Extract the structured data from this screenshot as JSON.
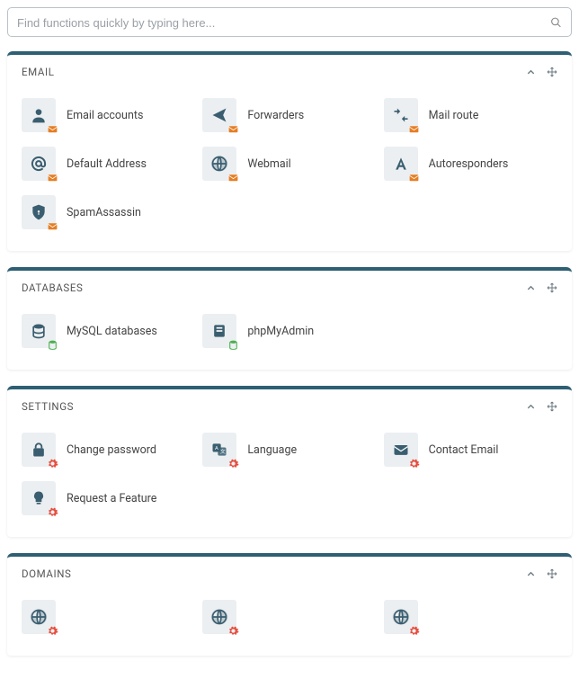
{
  "search": {
    "placeholder": "Find functions quickly by typing here..."
  },
  "panels": [
    {
      "key": "email",
      "title": "EMAIL",
      "badge": "env",
      "items": [
        {
          "label": "Email accounts",
          "icon": "user",
          "name": "email-accounts"
        },
        {
          "label": "Forwarders",
          "icon": "send",
          "name": "forwarders"
        },
        {
          "label": "Mail route",
          "icon": "route",
          "name": "mail-route"
        },
        {
          "label": "Default Address",
          "icon": "at",
          "name": "default-address"
        },
        {
          "label": "Webmail",
          "icon": "globe",
          "name": "webmail"
        },
        {
          "label": "Autoresponders",
          "icon": "typea",
          "name": "autoresponders"
        },
        {
          "label": "SpamAssassin",
          "icon": "shield",
          "name": "spam-assassin"
        }
      ]
    },
    {
      "key": "databases",
      "title": "DATABASES",
      "badge": "db",
      "items": [
        {
          "label": "MySQL databases",
          "icon": "dbcyl",
          "name": "mysql-databases"
        },
        {
          "label": "phpMyAdmin",
          "icon": "pma",
          "name": "phpmyadmin"
        }
      ]
    },
    {
      "key": "settings",
      "title": "SETTINGS",
      "badge": "gear",
      "items": [
        {
          "label": "Change password",
          "icon": "lock",
          "name": "change-password"
        },
        {
          "label": "Language",
          "icon": "lang",
          "name": "language"
        },
        {
          "label": "Contact Email",
          "icon": "envelope",
          "name": "contact-email"
        },
        {
          "label": "Request a Feature",
          "icon": "bulb",
          "name": "request-feature"
        }
      ]
    },
    {
      "key": "domains",
      "title": "DOMAINS",
      "badge": "gear",
      "items": [
        {
          "label": "",
          "icon": "globe",
          "name": "domain-item-1"
        },
        {
          "label": "",
          "icon": "globe",
          "name": "domain-item-2"
        },
        {
          "label": "",
          "icon": "globe",
          "name": "domain-item-3"
        }
      ]
    }
  ]
}
